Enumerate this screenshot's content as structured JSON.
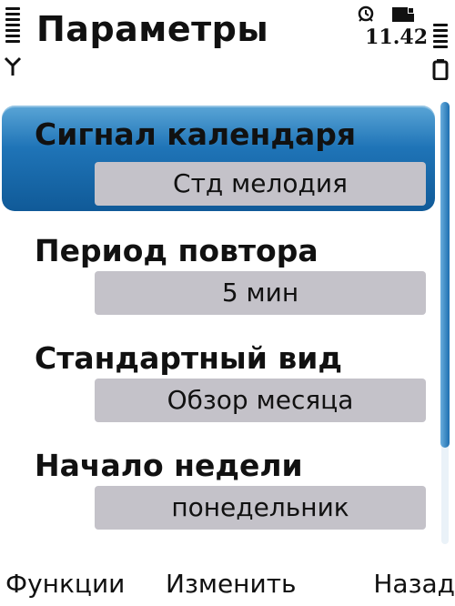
{
  "status": {
    "title": "Параметры",
    "clock": "11.42",
    "icons": [
      "signal-icon",
      "antenna-icon",
      "alarm-icon",
      "mail-icon",
      "battery-icon"
    ]
  },
  "settings": [
    {
      "label": "Сигнал календаря",
      "value": "Стд мелодия"
    },
    {
      "label": "Период повтора",
      "value": "5 мин"
    },
    {
      "label": "Стандартный вид",
      "value": "Обзор месяца"
    },
    {
      "label": "Начало недели",
      "value": "понедельник"
    }
  ],
  "softkeys": {
    "left": "Функции",
    "middle": "Изменить",
    "right": "Назад"
  },
  "colors": {
    "highlight": "#1f74b7",
    "value_box": "#c4c2c9",
    "background": "#ffffff"
  }
}
